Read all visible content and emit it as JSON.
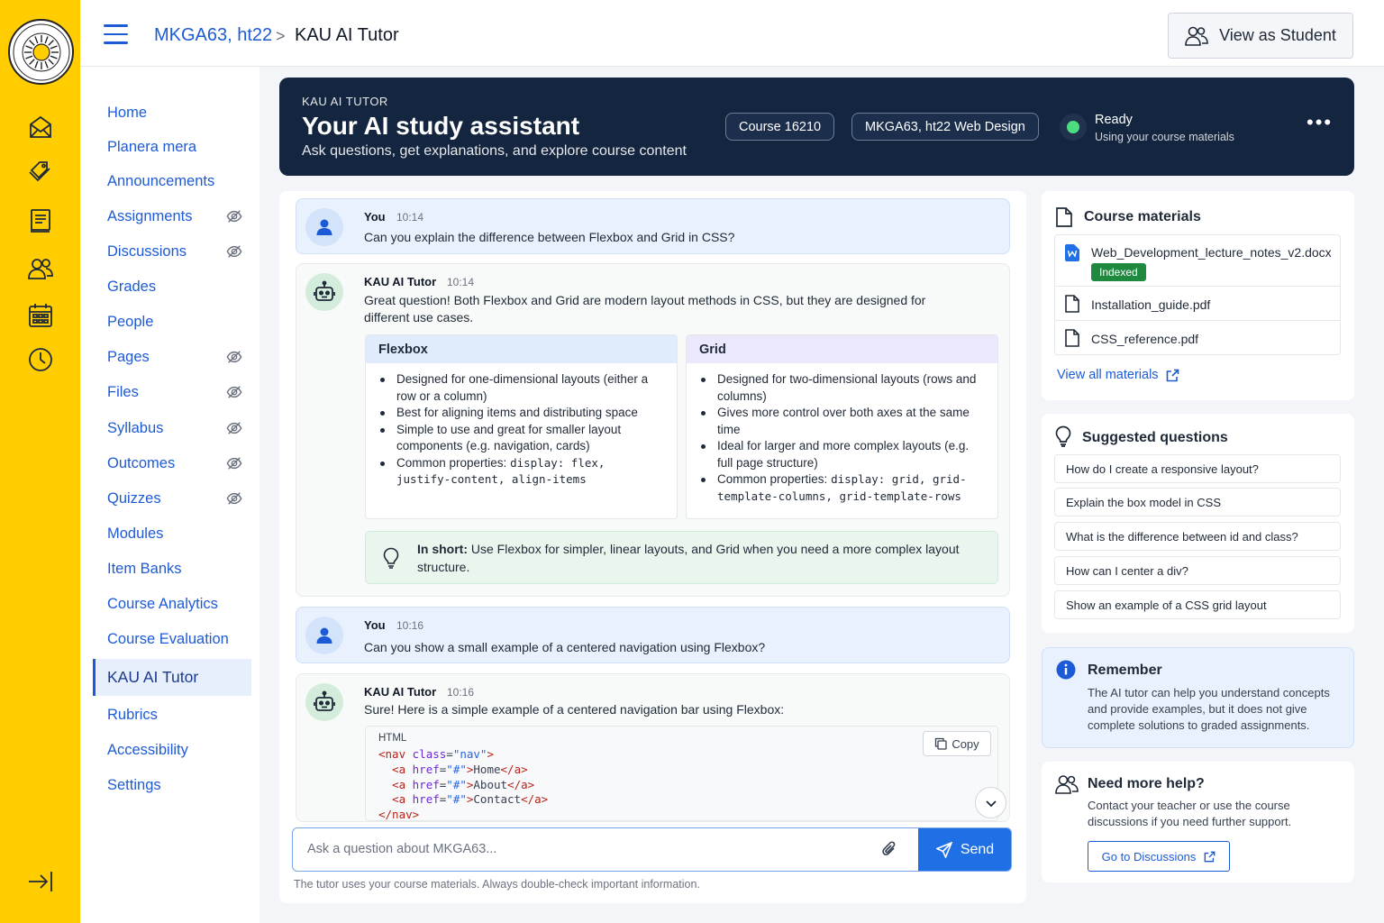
{
  "breadcrumb": {
    "course": "MKGA63, ht22",
    "separator": ">",
    "page": "KAU AI Tutor"
  },
  "header": {
    "view_as_student": "View as Student"
  },
  "nav": {
    "items": [
      {
        "label": "Home",
        "hidden_icon": false
      },
      {
        "label": "Planera mera",
        "hidden_icon": false
      },
      {
        "label": "Announcements",
        "hidden_icon": false
      },
      {
        "label": "Assignments",
        "hidden_icon": true
      },
      {
        "label": "Discussions",
        "hidden_icon": true
      },
      {
        "label": "Grades",
        "hidden_icon": false
      },
      {
        "label": "People",
        "hidden_icon": false
      },
      {
        "label": "Pages",
        "hidden_icon": true
      },
      {
        "label": "Files",
        "hidden_icon": true
      },
      {
        "label": "Syllabus",
        "hidden_icon": true
      },
      {
        "label": "Outcomes",
        "hidden_icon": true
      },
      {
        "label": "Quizzes",
        "hidden_icon": true
      },
      {
        "label": "Modules",
        "hidden_icon": false
      },
      {
        "label": "Item Banks",
        "hidden_icon": false
      },
      {
        "label": "Course Analytics",
        "hidden_icon": false
      },
      {
        "label": "Course Evaluation",
        "hidden_icon": false
      },
      {
        "label": "KAU AI Tutor",
        "hidden_icon": false,
        "active": true
      },
      {
        "label": "Rubrics",
        "hidden_icon": false
      },
      {
        "label": "Accessibility",
        "hidden_icon": false
      },
      {
        "label": "Settings",
        "hidden_icon": false
      }
    ]
  },
  "rail": {
    "icons": [
      "account-icon",
      "dashboard-icon",
      "courses-icon",
      "groups-icon",
      "calendar-icon",
      "history-icon",
      "collapse-icon"
    ]
  },
  "hero": {
    "kicker": "KAU AI TUTOR",
    "title": "Your AI study assistant",
    "subtitle": "Ask questions, get explanations, and explore course content",
    "pill_course": "Course 16210",
    "pill_name": "MKGA63, ht22 Web Design",
    "status_title": "Ready",
    "status_sub": "Using your course materials",
    "more": "•••"
  },
  "chat": {
    "m1": {
      "who": "You",
      "time": "10:14",
      "text": "Can you explain the difference between Flexbox and Grid in CSS?"
    },
    "m2": {
      "who": "KAU AI Tutor",
      "time": "10:14",
      "text": "Great question! Both Flexbox and Grid are modern layout methods in CSS, but they are designed for different use cases.",
      "flex": {
        "title": "Flexbox",
        "b1": "Designed for one-dimensional layouts (either a row or a column)",
        "b2": "Best for aligning items and distributing space",
        "b3": "Simple to use and great for smaller layout components (e.g. navigation, cards)",
        "b4_label": "Common properties:",
        "b4_code": "display: flex, justify-content, align-items"
      },
      "grid": {
        "title": "Grid",
        "b1": "Designed for two-dimensional layouts (rows and columns)",
        "b2": "Gives more control over both axes at the same time",
        "b3": "Ideal for larger and more complex layouts (e.g. full page structure)",
        "b4_label": "Common properties:",
        "b4_code": "display: grid, grid-template-columns, grid-template-rows"
      },
      "short_label": "In short:",
      "short_text": "Use Flexbox for simpler, linear layouts, and Grid when you need a more complex layout structure."
    },
    "m3": {
      "who": "You",
      "time": "10:16",
      "text": "Can you show a small example of a centered navigation using Flexbox?"
    },
    "m4": {
      "who": "KAU AI Tutor",
      "time": "10:16",
      "text": "Sure! Here is a simple example of a centered navigation bar using Flexbox:",
      "code_lang": "HTML",
      "copy": "Copy",
      "code_line1_tag": "nav",
      "code_line1_attr": "class",
      "code_line1_val": "\"nav\"",
      "links": [
        "Home",
        "About",
        "Contact"
      ]
    },
    "input_placeholder": "Ask a question about MKGA63...",
    "send": "Send",
    "disclaimer": "The tutor uses your course materials. Always double-check important information."
  },
  "materials": {
    "title": "Course materials",
    "files": [
      {
        "name": "Web_Development_lecture_notes_v2.docx",
        "badge": "Indexed"
      },
      {
        "name": "Installation_guide.pdf"
      },
      {
        "name": "CSS_reference.pdf"
      }
    ],
    "view_all": "View all materials"
  },
  "suggested": {
    "title": "Suggested questions",
    "items": [
      "How do I create a responsive layout?",
      "Explain the box model in CSS",
      "What is the difference between id and class?",
      "How can I center a div?",
      "Show an example of a CSS grid layout"
    ]
  },
  "remember": {
    "title": "Remember",
    "text": "The AI tutor can help you understand concepts and provide examples, but it does not give complete solutions to graded assignments."
  },
  "help": {
    "title": "Need more help?",
    "text": "Contact your teacher or use the course discussions if you need further support.",
    "button": "Go to Discussions"
  },
  "colors": {
    "rail": "#ffcd00",
    "accent": "#1d5bd6",
    "hero": "#14253f",
    "send": "#1f6fe5",
    "ready": "#4ade80"
  }
}
